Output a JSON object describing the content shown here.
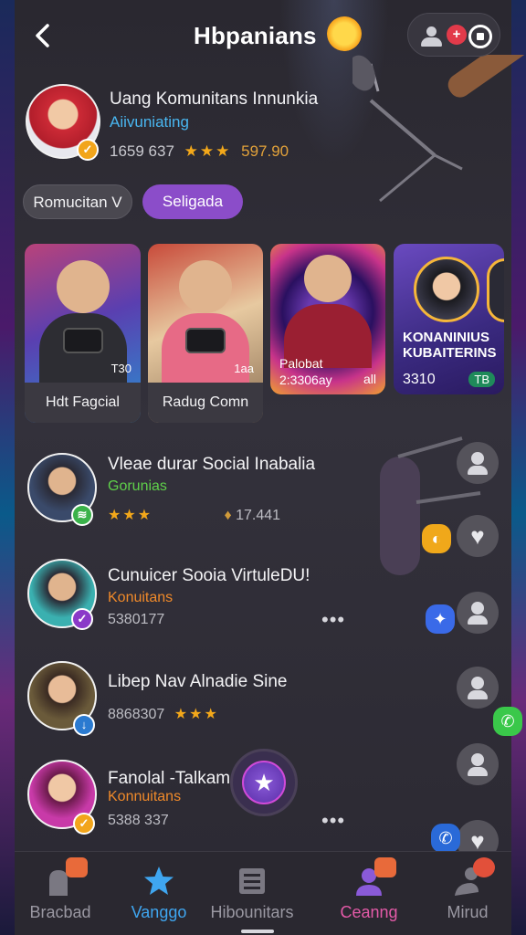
{
  "header": {
    "title": "Hbpanians",
    "notification_badge": "+"
  },
  "profile": {
    "name": "Uang Komunitans Innunkia",
    "subtitle": "Aiivuniating",
    "stats_prefix": "1659 637",
    "stars": "★★★",
    "score": "597.90",
    "verified_mark": "✓"
  },
  "chips": [
    {
      "label": "Romucitan V"
    },
    {
      "label": "Seligada"
    }
  ],
  "cards": [
    {
      "caption": "Hdt Fagcial",
      "count": "T30"
    },
    {
      "caption": "Radug Comn",
      "count": "1aa"
    },
    {
      "meta_line1": "Palobat",
      "meta_line2": "2:3306ay",
      "extra": "all"
    },
    {
      "title_line1": "KONANINIUS",
      "title_line2": "KUBAITERINS",
      "count": "3310",
      "badge": "TB"
    }
  ],
  "list": [
    {
      "title": "Vleae durar Social Inabalia",
      "subtitle": "Gorunias",
      "stars": "★★★",
      "stats": "17.441",
      "subtitle_color": "#5fd04a"
    },
    {
      "title": "Cunuicer Sooia VirtuleDU!",
      "subtitle": "Konuitans",
      "stats": "5380177",
      "more": "•••",
      "subtitle_color": "#f08a2a"
    },
    {
      "title": "Libep Nav Alnadie Sine",
      "stats": "8868307",
      "stars": "★★★"
    },
    {
      "title": "Fanolal -Talkam",
      "subtitle": "Konnuitans",
      "stats": "5388 337",
      "more": "•••",
      "subtitle_color": "#f08a2a"
    }
  ],
  "fab": {
    "icon": "★"
  },
  "nav": [
    {
      "label": "Bracbad"
    },
    {
      "label": "Vanggo"
    },
    {
      "label": "Hibounitars"
    },
    {
      "label": "Ceanng"
    },
    {
      "label": "Mirud"
    }
  ],
  "colors": {
    "accent_purple": "#8b4dc9",
    "accent_blue": "#3fa6f0",
    "accent_pink": "#e45aa8",
    "gold": "#f3a81a"
  }
}
